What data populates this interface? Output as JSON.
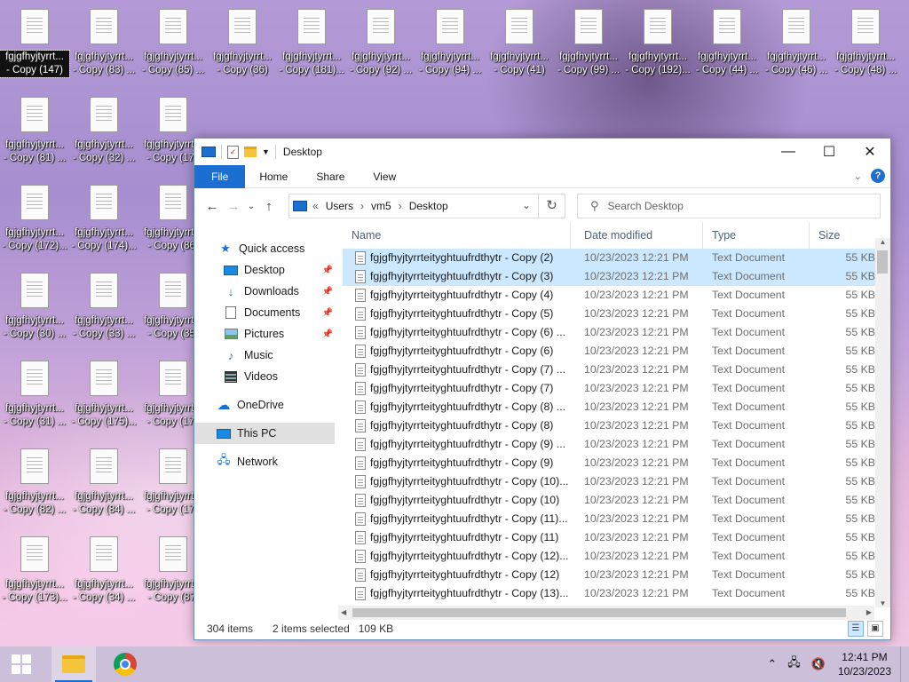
{
  "desktop": {
    "icons": [
      {
        "label": "fgjgfhyjtyrrt...",
        "label2": "- Copy (147)",
        "col": 0,
        "row": 0,
        "selected": true
      },
      {
        "label": "fgjgfhyjtyrrt...",
        "label2": "- Copy (83) ...",
        "col": 1,
        "row": 0
      },
      {
        "label": "fgjgfhyjtyrrt...",
        "label2": "- Copy (85) ...",
        "col": 2,
        "row": 0
      },
      {
        "label": "fgjgfhyjtyrrt...",
        "label2": "- Copy (36)",
        "col": 3,
        "row": 0
      },
      {
        "label": "fgjgfhyjtyrrt...",
        "label2": "- Copy (181)...",
        "col": 4,
        "row": 0
      },
      {
        "label": "fgjgfhyjtyrrt...",
        "label2": "- Copy (92) ...",
        "col": 5,
        "row": 0
      },
      {
        "label": "fgjgfhyjtyrrt...",
        "label2": "- Copy (94) ...",
        "col": 6,
        "row": 0
      },
      {
        "label": "fgjgfhyjtyrrt...",
        "label2": "- Copy (41)",
        "col": 7,
        "row": 0
      },
      {
        "label": "fgjgfhyjtyrrt...",
        "label2": "- Copy (99) ...",
        "col": 8,
        "row": 0
      },
      {
        "label": "fgjgfhyjtyrrt...",
        "label2": "- Copy (192)...",
        "col": 9,
        "row": 0
      },
      {
        "label": "fgjgfhyjtyrrt...",
        "label2": "- Copy (44) ...",
        "col": 10,
        "row": 0
      },
      {
        "label": "fgjgfhyjtyrrt...",
        "label2": "- Copy (46) ...",
        "col": 11,
        "row": 0
      },
      {
        "label": "fgjgfhyjtyrrt...",
        "label2": "- Copy (48) ...",
        "col": 12,
        "row": 0
      },
      {
        "label": "fgjgfhyjtyrrt...",
        "label2": "- Copy (81) ...",
        "col": 0,
        "row": 1
      },
      {
        "label": "fgjgfhyjtyrrt...",
        "label2": "- Copy (32) ...",
        "col": 1,
        "row": 1
      },
      {
        "label": "fgjgfhyjtyrrt...",
        "label2": "- Copy (176",
        "col": 2,
        "row": 1
      },
      {
        "label": "fgjgfhyjtyrrt...",
        "label2": "- Copy (172)...",
        "col": 0,
        "row": 2
      },
      {
        "label": "fgjgfhyjtyrrt...",
        "label2": "- Copy (174)...",
        "col": 1,
        "row": 2
      },
      {
        "label": "fgjgfhyjtyrrt...",
        "label2": "- Copy (86)",
        "col": 2,
        "row": 2
      },
      {
        "label": "fgjgfhyjtyrrt...",
        "label2": "- Copy (30) ...",
        "col": 0,
        "row": 3
      },
      {
        "label": "fgjgfhyjtyrrt...",
        "label2": "- Copy (33) ...",
        "col": 1,
        "row": 3
      },
      {
        "label": "fgjgfhyjtyrrt...",
        "label2": "- Copy (35)",
        "col": 2,
        "row": 3
      },
      {
        "label": "fgjgfhyjtyrrt...",
        "label2": "- Copy (31) ...",
        "col": 0,
        "row": 4
      },
      {
        "label": "fgjgfhyjtyrrt...",
        "label2": "- Copy (175)...",
        "col": 1,
        "row": 4
      },
      {
        "label": "fgjgfhyjtyrrt...",
        "label2": "- Copy (177",
        "col": 2,
        "row": 4
      },
      {
        "label": "fgjgfhyjtyrrt...",
        "label2": "- Copy (82) ...",
        "col": 0,
        "row": 5
      },
      {
        "label": "fgjgfhyjtyrrt...",
        "label2": "- Copy (84) ...",
        "col": 1,
        "row": 5
      },
      {
        "label": "fgjgfhyjtyrrt...",
        "label2": "- Copy (178",
        "col": 2,
        "row": 5
      },
      {
        "label": "fgjgfhyjtyrrt...",
        "label2": "- Copy (173)...",
        "col": 0,
        "row": 6
      },
      {
        "label": "fgjgfhyjtyrrt...",
        "label2": "- Copy (34) ...",
        "col": 1,
        "row": 6
      },
      {
        "label": "fgjgfhyjtyrrt...",
        "label2": "- Copy (87)",
        "col": 2,
        "row": 6
      }
    ]
  },
  "window": {
    "title": "Desktop",
    "ribbon_tabs": {
      "file": "File",
      "home": "Home",
      "share": "Share",
      "view": "View"
    },
    "help": "?",
    "address": {
      "prefix": "«",
      "crumbs": [
        "Users",
        "vm5",
        "Desktop"
      ],
      "sep": "›"
    },
    "search_placeholder": "Search Desktop",
    "nav": {
      "quick_access": "Quick access",
      "desktop": "Desktop",
      "downloads": "Downloads",
      "documents": "Documents",
      "pictures": "Pictures",
      "music": "Music",
      "videos": "Videos",
      "onedrive": "OneDrive",
      "this_pc": "This PC",
      "network": "Network"
    },
    "columns": {
      "name": "Name",
      "date": "Date modified",
      "type": "Type",
      "size": "Size"
    },
    "files": [
      {
        "name": "fgjgfhyjtyrrteityghtuufrdthytr - Copy (2)",
        "date": "10/23/2023 12:21 PM",
        "type": "Text Document",
        "size": "55 KB",
        "selected": true
      },
      {
        "name": "fgjgfhyjtyrrteityghtuufrdthytr - Copy (3)",
        "date": "10/23/2023 12:21 PM",
        "type": "Text Document",
        "size": "55 KB",
        "selected": true
      },
      {
        "name": "fgjgfhyjtyrrteityghtuufrdthytr - Copy (4)",
        "date": "10/23/2023 12:21 PM",
        "type": "Text Document",
        "size": "55 KB"
      },
      {
        "name": "fgjgfhyjtyrrteityghtuufrdthytr - Copy (5)",
        "date": "10/23/2023 12:21 PM",
        "type": "Text Document",
        "size": "55 KB"
      },
      {
        "name": "fgjgfhyjtyrrteityghtuufrdthytr - Copy (6) ...",
        "date": "10/23/2023 12:21 PM",
        "type": "Text Document",
        "size": "55 KB"
      },
      {
        "name": "fgjgfhyjtyrrteityghtuufrdthytr - Copy (6)",
        "date": "10/23/2023 12:21 PM",
        "type": "Text Document",
        "size": "55 KB"
      },
      {
        "name": "fgjgfhyjtyrrteityghtuufrdthytr - Copy (7) ...",
        "date": "10/23/2023 12:21 PM",
        "type": "Text Document",
        "size": "55 KB"
      },
      {
        "name": "fgjgfhyjtyrrteityghtuufrdthytr - Copy (7)",
        "date": "10/23/2023 12:21 PM",
        "type": "Text Document",
        "size": "55 KB"
      },
      {
        "name": "fgjgfhyjtyrrteityghtuufrdthytr - Copy (8) ...",
        "date": "10/23/2023 12:21 PM",
        "type": "Text Document",
        "size": "55 KB"
      },
      {
        "name": "fgjgfhyjtyrrteityghtuufrdthytr - Copy (8)",
        "date": "10/23/2023 12:21 PM",
        "type": "Text Document",
        "size": "55 KB"
      },
      {
        "name": "fgjgfhyjtyrrteityghtuufrdthytr - Copy (9) ...",
        "date": "10/23/2023 12:21 PM",
        "type": "Text Document",
        "size": "55 KB"
      },
      {
        "name": "fgjgfhyjtyrrteityghtuufrdthytr - Copy (9)",
        "date": "10/23/2023 12:21 PM",
        "type": "Text Document",
        "size": "55 KB"
      },
      {
        "name": "fgjgfhyjtyrrteityghtuufrdthytr - Copy (10)...",
        "date": "10/23/2023 12:21 PM",
        "type": "Text Document",
        "size": "55 KB"
      },
      {
        "name": "fgjgfhyjtyrrteityghtuufrdthytr - Copy (10)",
        "date": "10/23/2023 12:21 PM",
        "type": "Text Document",
        "size": "55 KB"
      },
      {
        "name": "fgjgfhyjtyrrteityghtuufrdthytr - Copy (11)...",
        "date": "10/23/2023 12:21 PM",
        "type": "Text Document",
        "size": "55 KB"
      },
      {
        "name": "fgjgfhyjtyrrteityghtuufrdthytr - Copy (11)",
        "date": "10/23/2023 12:21 PM",
        "type": "Text Document",
        "size": "55 KB"
      },
      {
        "name": "fgjgfhyjtyrrteityghtuufrdthytr - Copy (12)...",
        "date": "10/23/2023 12:21 PM",
        "type": "Text Document",
        "size": "55 KB"
      },
      {
        "name": "fgjgfhyjtyrrteityghtuufrdthytr - Copy (12)",
        "date": "10/23/2023 12:21 PM",
        "type": "Text Document",
        "size": "55 KB"
      },
      {
        "name": "fgjgfhyjtyrrteityghtuufrdthytr - Copy (13)...",
        "date": "10/23/2023 12:21 PM",
        "type": "Text Document",
        "size": "55 KB"
      }
    ],
    "status": {
      "items": "304 items",
      "selected": "2 items selected",
      "size": "109 KB"
    }
  },
  "taskbar": {
    "time": "12:41 PM",
    "date": "10/23/2023"
  },
  "colors": {
    "accent": "#1a6fd0",
    "selection": "#cce8ff"
  }
}
